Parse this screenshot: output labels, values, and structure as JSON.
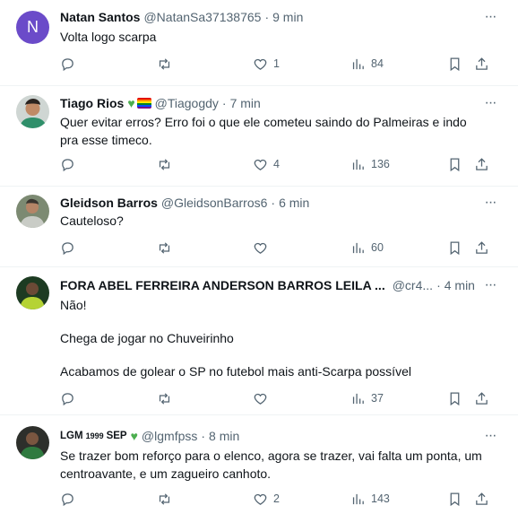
{
  "tweets": [
    {
      "name": "Natan Santos",
      "handle": "@NatanSa37138765",
      "time": "9 min",
      "avatar_letter": "N",
      "text": [
        "Volta logo scarpa"
      ],
      "replies": "",
      "retweets": "",
      "likes": "1",
      "views": "84"
    },
    {
      "name": "Tiago Rios",
      "handle": "@Tiagogdy",
      "time": "7 min",
      "name_badges": [
        "green-heart-icon",
        "rainbow-flag-icon"
      ],
      "text": [
        "Quer evitar erros? Erro foi o que ele cometeu saindo do Palmeiras e indo",
        "pra esse timeco."
      ],
      "replies": "",
      "retweets": "",
      "likes": "4",
      "views": "136"
    },
    {
      "name": "Gleidson Barros",
      "handle": "@GleidsonBarros6",
      "time": "6 min",
      "text": [
        "Cauteloso?"
      ],
      "replies": "",
      "retweets": "",
      "likes": "",
      "views": "60"
    },
    {
      "name": "FORA ABEL FERREIRA ANDERSON BARROS LEILA ...",
      "handle": "@cr4...",
      "time": "4 min",
      "text": [
        "Não!",
        "",
        "Chega de jogar no Chuveirinho",
        "",
        "Acabamos de golear o SP no futebol mais anti-Scarpa possível"
      ],
      "replies": "",
      "retweets": "",
      "likes": "",
      "views": "37"
    },
    {
      "name_part1": "LGM",
      "name_sup": "1999",
      "name_part2": "SEP",
      "name_badges": [
        "green-heart-icon"
      ],
      "handle": "@lgmfpss",
      "time": "8 min",
      "text": [
        "Se trazer bom reforço para o elenco, agora se trazer, vai falta um ponta, um",
        "centroavante, e um zagueiro canhoto."
      ],
      "replies": "",
      "retweets": "",
      "likes": "2",
      "views": "143"
    }
  ],
  "separator": "·",
  "colors": {
    "text": "#0f1419",
    "secondary": "#536471",
    "border": "#eff3f4",
    "green_heart": "#4cae4f",
    "avatar_n": "#6b4bc9"
  }
}
